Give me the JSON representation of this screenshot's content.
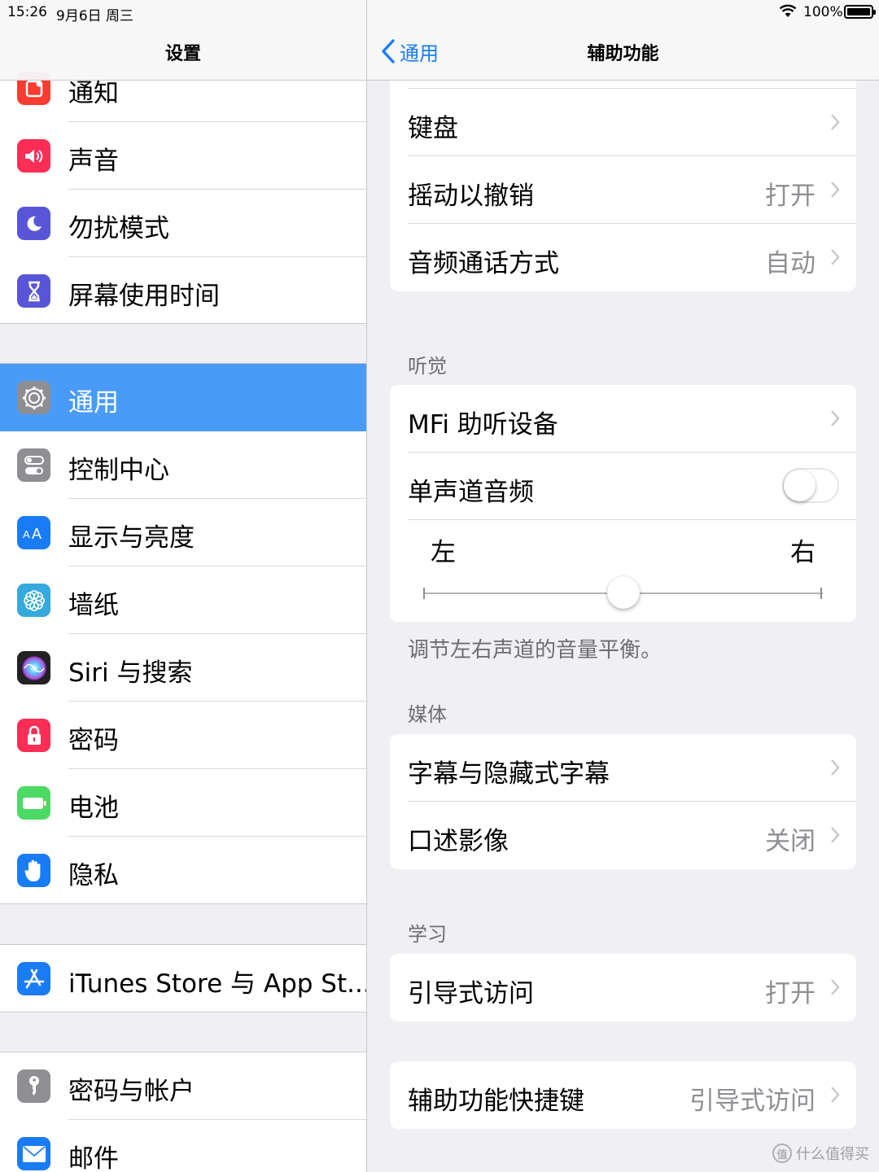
{
  "status_bar": {
    "time": "15:26",
    "date": "9月6日 周三",
    "battery_percent": "100%",
    "battery_level": 1.0
  },
  "sidebar": {
    "title": "设置",
    "items": [
      {
        "label": "通知",
        "icon": "notifications-icon",
        "color": "#fe3b30"
      },
      {
        "label": "声音",
        "icon": "sounds-icon",
        "color": "#fe2d55"
      },
      {
        "label": "勿扰模式",
        "icon": "moon-icon",
        "color": "#5856d6"
      },
      {
        "label": "屏幕使用时间",
        "icon": "hourglass-icon",
        "color": "#5856d6"
      },
      {
        "label": "通用",
        "icon": "gear-icon",
        "color": "#8e8e93"
      },
      {
        "label": "控制中心",
        "icon": "toggles-icon",
        "color": "#8e8e93"
      },
      {
        "label": "显示与亮度",
        "icon": "text-size-icon",
        "color": "#1a7cf5"
      },
      {
        "label": "墙纸",
        "icon": "flower-icon",
        "color": "#36aadc"
      },
      {
        "label": "Siri 与搜索",
        "icon": "siri-icon",
        "color": "#222"
      },
      {
        "label": "密码",
        "icon": "lock-icon",
        "color": "#fe3b30"
      },
      {
        "label": "电池",
        "icon": "battery-icon",
        "color": "#4cd964"
      },
      {
        "label": "隐私",
        "icon": "hand-icon",
        "color": "#1a7cf5"
      },
      {
        "label": "iTunes Store 与 App St...",
        "icon": "app-store-icon",
        "color": "#1a7cf5"
      },
      {
        "label": "密码与帐户",
        "icon": "key-icon",
        "color": "#8e8e93"
      },
      {
        "label": "邮件",
        "icon": "mail-icon",
        "color": "#1a7cf5"
      }
    ],
    "selected": "通用"
  },
  "detail": {
    "back_label": "通用",
    "title": "辅助功能",
    "group1": [
      {
        "label": "键盘",
        "value": ""
      },
      {
        "label": "摇动以撤销",
        "value": "打开"
      },
      {
        "label": "音频通话方式",
        "value": "自动"
      }
    ],
    "hearing": {
      "header": "听觉",
      "mfi_label": "MFi 助听设备",
      "mono_label": "单声道音频",
      "mono_on": false,
      "balance_left": "左",
      "balance_right": "右",
      "balance_value": 0.5,
      "footer": "调节左右声道的音量平衡。"
    },
    "media": {
      "header": "媒体",
      "items": [
        {
          "label": "字幕与隐藏式字幕",
          "value": ""
        },
        {
          "label": "口述影像",
          "value": "关闭"
        }
      ]
    },
    "learning": {
      "header": "学习",
      "items": [
        {
          "label": "引导式访问",
          "value": "打开"
        }
      ]
    },
    "shortcut": {
      "label": "辅助功能快捷键",
      "value": "引导式访问"
    }
  },
  "watermark": "什么值得买",
  "colors": {
    "accent": "#1a7cf5",
    "selected_row": "#4a9bf8",
    "background": "#efeff4"
  }
}
